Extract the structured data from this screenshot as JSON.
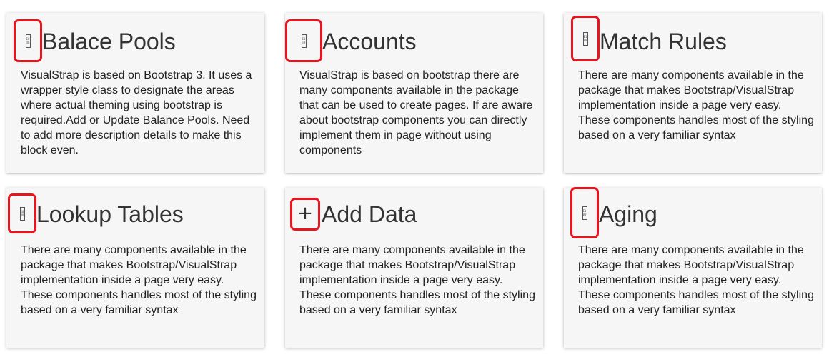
{
  "colors": {
    "card_background": "#f6f6f6",
    "highlight": "#e8141e",
    "title_text": "#333333",
    "body_text": "#222222"
  },
  "cards": [
    {
      "title": "Balace Pools",
      "icon": "missing-glyph-icon",
      "icon_glyph_top": "E0",
      "icon_glyph_bottom": "48",
      "body": "VisualStrap is based on Bootstrap 3. It uses a wrapper style class to designate the areas where actual theming using bootstrap is required.Add or Update Balance Pools. Need to add more description details to make this block even."
    },
    {
      "title": "Accounts",
      "icon": "missing-glyph-icon",
      "icon_glyph_top": "E0",
      "icon_glyph_bottom": "19",
      "body": "VisualStrap is based on bootstrap there are many components available in the package that can be used to create pages. If are aware about bootstrap components you can directly implement them in page without using components"
    },
    {
      "title": "Match Rules",
      "icon": "missing-glyph-icon",
      "icon_glyph_top": "E1",
      "icon_glyph_bottom": "88",
      "body": "There are many components available in the package that makes Bootstrap/VisualStrap implementation inside a page very easy. These components handles most of the styling based on a very familiar syntax"
    },
    {
      "title": "Lookup Tables",
      "icon": "missing-glyph-icon",
      "icon_glyph_top": "E0",
      "icon_glyph_bottom": "48",
      "body": "There are many components available in the package that makes Bootstrap/VisualStrap implementation inside a page very easy. These components handles most of the styling based on a very familiar syntax"
    },
    {
      "title": "Add Data",
      "icon": "plus-icon",
      "icon_glyph": "+",
      "body": "There are many components available in the package that makes Bootstrap/VisualStrap implementation inside a page very easy. These components handles most of the styling based on a very familiar syntax"
    },
    {
      "title": "Aging",
      "icon": "missing-glyph-icon",
      "icon_glyph_top": "E1",
      "icon_glyph_bottom": "09",
      "body": "There are many components available in the package that makes Bootstrap/VisualStrap implementation inside a page very easy. These components handles most of the styling based on a very familiar syntax"
    }
  ]
}
